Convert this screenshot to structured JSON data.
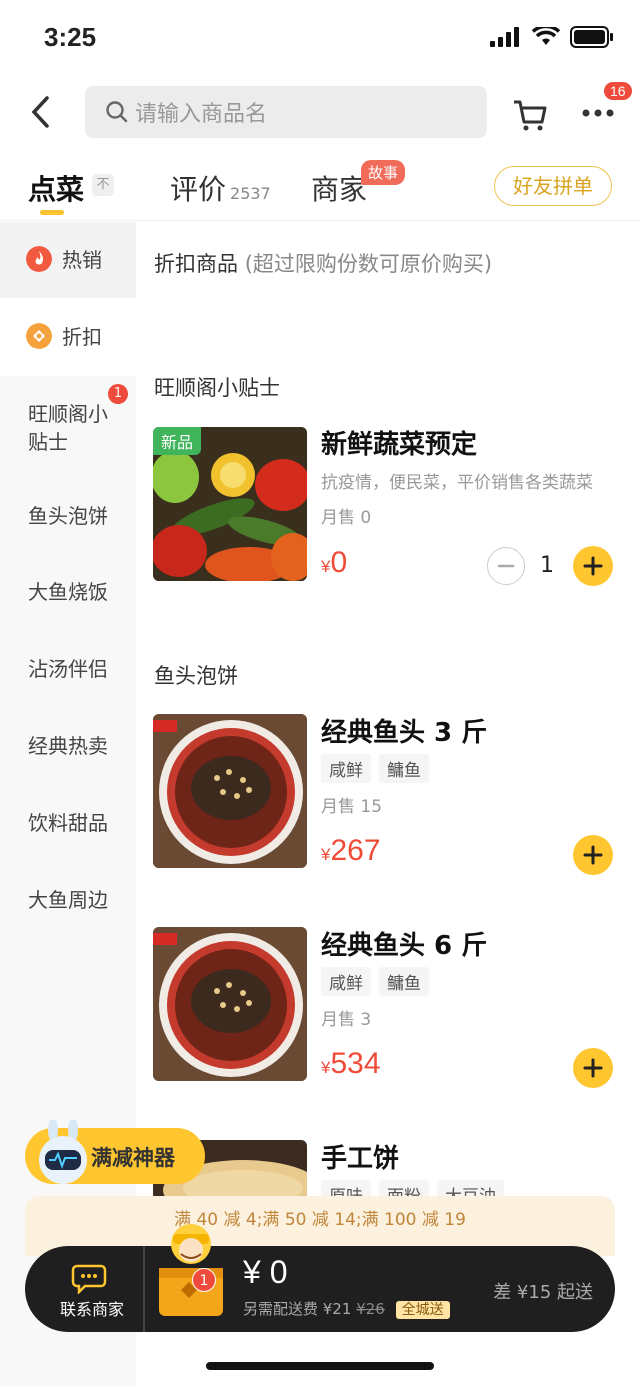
{
  "status": {
    "time": "3:25"
  },
  "search": {
    "placeholder": "请输入商品名"
  },
  "more_badge": "16",
  "tabs": {
    "order": "点菜",
    "pin": "不",
    "review": "评价",
    "review_count": "2537",
    "merchant": "商家",
    "story": "故事",
    "friend": "好友拼单"
  },
  "sidebar": {
    "items": [
      {
        "label": "热销"
      },
      {
        "label": "折扣"
      },
      {
        "label": "旺顺阁小贴士"
      },
      {
        "label": "鱼头泡饼"
      },
      {
        "label": "大鱼烧饭"
      },
      {
        "label": "沾汤伴侣"
      },
      {
        "label": "经典热卖"
      },
      {
        "label": "饮料甜品"
      },
      {
        "label": "大鱼周边"
      }
    ],
    "badge": "1"
  },
  "sections": {
    "discount_title": "折扣商品",
    "discount_sub": "(超过限购份数可原价购买)",
    "tips_title": "旺顺阁小贴士",
    "fish_title": "鱼头泡饼"
  },
  "items": [
    {
      "name": "新鲜蔬菜预定",
      "tag_new": "新品",
      "desc": "抗疫情，便民菜，平价销售各类蔬菜",
      "sales": "月售 0",
      "currency": "¥",
      "price": "0",
      "qty": "1"
    },
    {
      "name": "经典鱼头 3 斤",
      "tags": [
        "咸鲜",
        "鳙鱼"
      ],
      "sales": "月售 15",
      "currency": "¥",
      "price": "267"
    },
    {
      "name": "经典鱼头 6 斤",
      "tags": [
        "咸鲜",
        "鳙鱼"
      ],
      "sales": "月售 3",
      "currency": "¥",
      "price": "534"
    },
    {
      "name": "手工饼",
      "tags": [
        "原味",
        "面粉",
        "大豆油"
      ]
    }
  ],
  "promo": {
    "pill": "满减神器",
    "strip": "满 40 减 4;满 50 减 14;满 100 减 19"
  },
  "bottom": {
    "contact": "联系商家",
    "cart_badge": "1",
    "total": "¥ 0",
    "fee_prefix": "另需配送费 ¥21",
    "fee_orig": "¥26",
    "city": "全城送",
    "min_send": "差 ¥15 起送"
  },
  "colors": {
    "accent": "#ffc62f",
    "price": "#f04b37",
    "badge": "#ee4b3c"
  }
}
